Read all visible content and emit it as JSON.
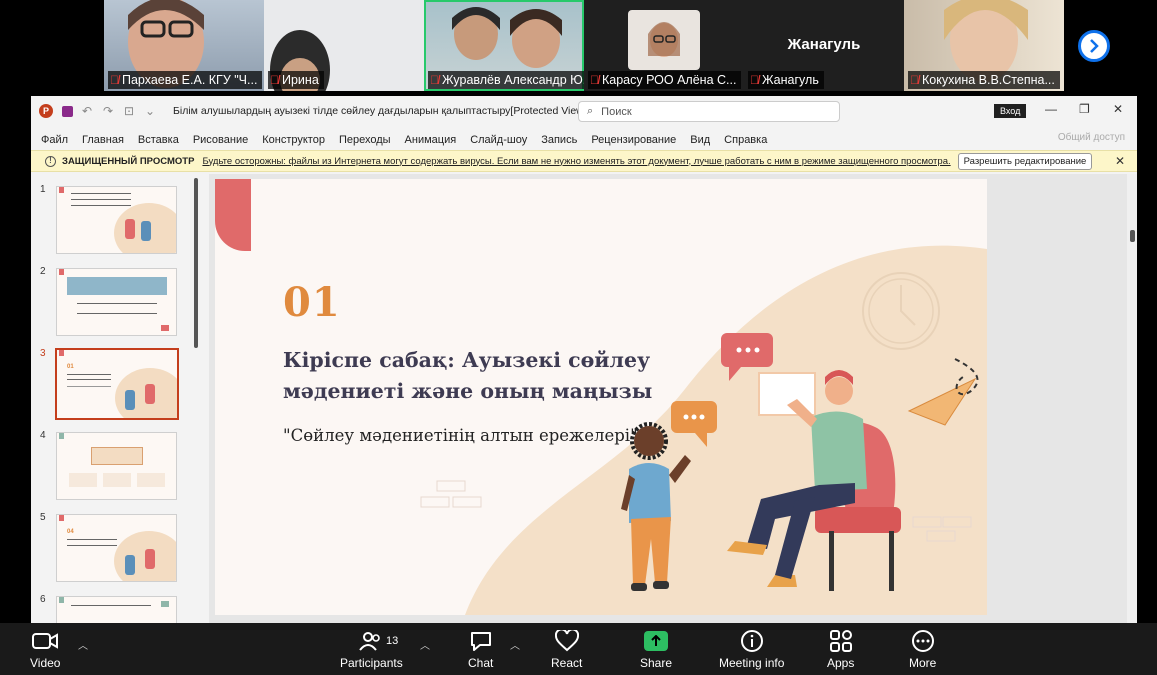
{
  "participants": [
    {
      "name": "Пархаева Е.А. КГУ \"Ч..."
    },
    {
      "name": "Ирина"
    },
    {
      "name": "Журавлёв Александр Ю..."
    },
    {
      "name": "Карасу РОО Алёна С..."
    },
    {
      "name": "Жанагуль",
      "display": "Жанагуль"
    },
    {
      "name": "Кокухина В.В.Степна..."
    }
  ],
  "ppt": {
    "title": "Білім алушылардың ауызекі тілде сөйлеу дағдыларын қалыптастыру[Protected View] - PowerP...",
    "search_placeholder": "Поиск",
    "signin": "Вход",
    "menu": [
      "Файл",
      "Главная",
      "Вставка",
      "Рисование",
      "Конструктор",
      "Переходы",
      "Анимация",
      "Слайд-шоу",
      "Запись",
      "Рецензирование",
      "Вид",
      "Справка"
    ],
    "share": "Общий доступ",
    "protected": {
      "title": "ЗАЩИЩЕННЫЙ ПРОСМОТР",
      "message": "Будьте осторожны: файлы из Интернета могут содержать вирусы. Если вам не нужно изменять этот документ, лучше работать с ним в режиме защищенного просмотра.",
      "button": "Разрешить редактирование"
    },
    "thumbnails": [
      "1",
      "2",
      "3",
      "4",
      "5",
      "6"
    ],
    "current_slide": "3",
    "slide": {
      "number": "01",
      "title": "Кіріспе сабақ: Ауызекі сөйлеу мәдениеті және оның маңызы",
      "subtitle": "\"Сөйлеу мәдениетінің алтын ережелері\""
    }
  },
  "toolbar": {
    "video": "Video",
    "participants": "Participants",
    "participants_count": "13",
    "chat": "Chat",
    "react": "React",
    "share": "Share",
    "meeting_info": "Meeting info",
    "apps": "Apps",
    "more": "More"
  },
  "colors": {
    "accent_red": "#e06a6a",
    "accent_orange": "#e08a3e",
    "title_ink": "#3e3b52",
    "zoom_green": "#2dbe62",
    "zoom_blue": "#0e71eb"
  }
}
